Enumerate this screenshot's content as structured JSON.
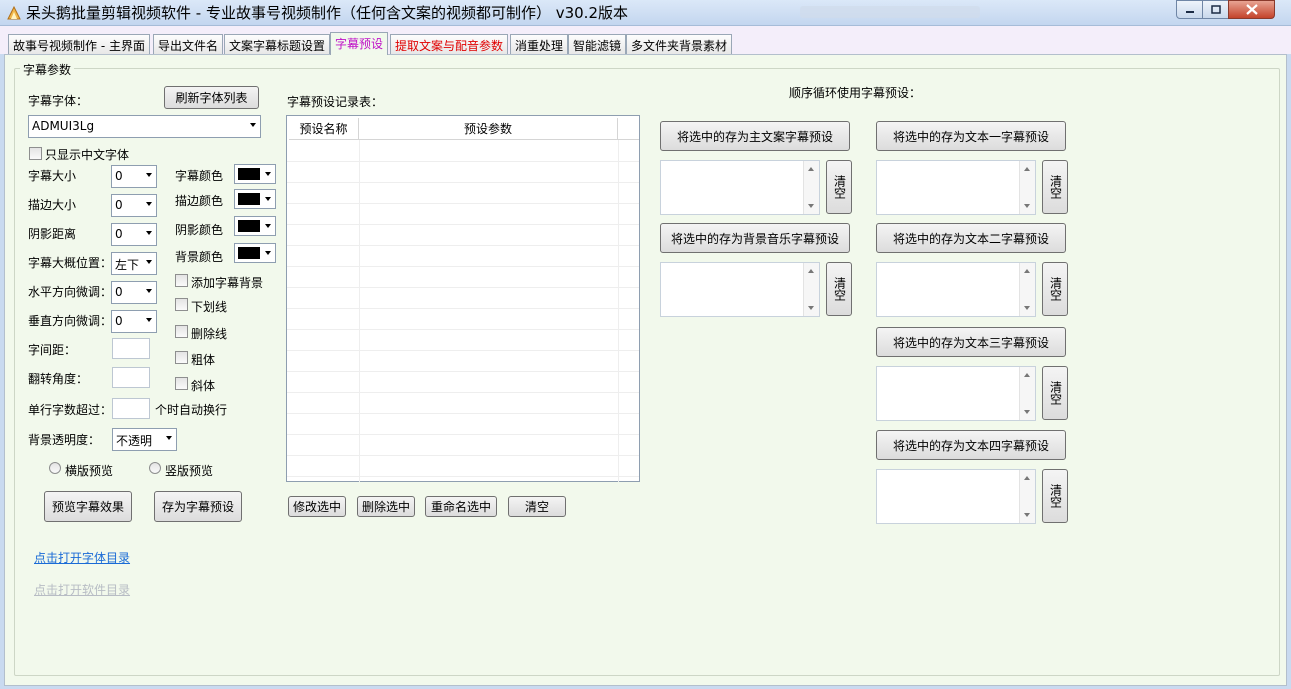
{
  "window": {
    "title": "呆头鹅批量剪辑视频软件 -  专业故事号视频制作（任何含文案的视频都可制作）  v30.2版本"
  },
  "tabs": [
    {
      "label": "故事号视频制作 - 主界面"
    },
    {
      "label": "导出文件名"
    },
    {
      "label": "文案字幕标题设置"
    },
    {
      "label": "字幕预设",
      "active": true
    },
    {
      "label": "提取文案与配音参数"
    },
    {
      "label": "消重处理"
    },
    {
      "label": "智能滤镜"
    },
    {
      "label": "多文件夹背景素材"
    }
  ],
  "group": {
    "label": "字幕参数"
  },
  "left": {
    "font_label": "字幕字体：",
    "refresh_fonts": "刷新字体列表",
    "font_value": "ADMUI3Lg",
    "only_chinese": "只显示中文字体",
    "font_size_label": "字幕大小",
    "font_size_value": "0",
    "stroke_size_label": "描边大小",
    "stroke_size_value": "0",
    "shadow_dist_label": "阴影距离",
    "shadow_dist_value": "0",
    "position_label": "字幕大概位置：",
    "position_value": "左下",
    "h_adjust_label": "水平方向微调：",
    "h_adjust_value": "0",
    "v_adjust_label": "垂直方向微调：",
    "v_adjust_value": "0",
    "spacing_label": "字间距：",
    "rotation_label": "翻转角度：",
    "wrap_prefix": "单行字数超过：",
    "wrap_suffix": "个时自动换行",
    "bg_opacity_label": "背景透明度：",
    "bg_opacity_value": "不透明",
    "font_color_label": "字幕颜色",
    "stroke_color_label": "描边颜色",
    "shadow_color_label": "阴影颜色",
    "bg_color_label": "背景颜色",
    "add_bg": "添加字幕背景",
    "underline": "下划线",
    "strikeout": "删除线",
    "bold": "粗体",
    "italic": "斜体",
    "landscape_preview": "横版预览",
    "portrait_preview": "竖版预览",
    "preview_btn": "预览字幕效果",
    "save_preset_btn": "存为字幕预设",
    "open_font_dir": "点击打开字体目录",
    "open_app_dir": "点击打开软件目录",
    "swatch_color": "#000000"
  },
  "middle": {
    "table_label": "字幕预设记录表：",
    "columns": [
      "预设名称",
      "预设参数"
    ],
    "modify_btn": "修改选中",
    "delete_btn": "删除选中",
    "rename_btn": "重命名选中",
    "clear_btn": "清空"
  },
  "right": {
    "title": "顺序循环使用字幕预设：",
    "save_main": "将选中的存为主文案字幕预设",
    "save_bgm": "将选中的存为背景音乐字幕预设",
    "save_text1": "将选中的存为文本一字幕预设",
    "save_text2": "将选中的存为文本二字幕预设",
    "save_text3": "将选中的存为文本三字幕预设",
    "save_text4": "将选中的存为文本四字幕预设",
    "clear_label": "清空"
  }
}
